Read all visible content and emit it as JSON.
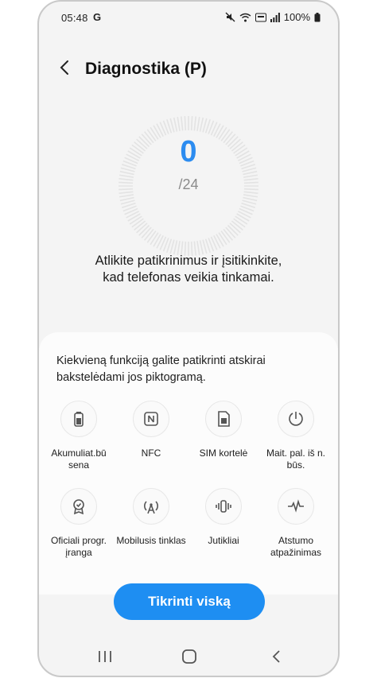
{
  "status_bar": {
    "time": "05:48",
    "google_badge": "G",
    "battery": "100%",
    "icons": [
      "mute-icon",
      "wifi-icon",
      "volte-icon",
      "signal-icon",
      "battery-icon"
    ]
  },
  "header": {
    "title": "Diagnostika (P)",
    "back_icon": "chevron-left-icon"
  },
  "gauge": {
    "value": "0",
    "total": "/24"
  },
  "description": "Atlikite patikrinimus ir įsitikinkite, kad telefonas veikia tinkamai.",
  "card": {
    "text": "Kiekvieną funkciją galite patikrinti atskirai bakstelėdami jos piktogramą.",
    "items": [
      {
        "label": "Akumuliat.bū sena",
        "icon": "battery-icon"
      },
      {
        "label": "NFC",
        "icon": "nfc-icon"
      },
      {
        "label": "SIM kortelė",
        "icon": "sim-card-icon"
      },
      {
        "label": "Mait. pal. iš n. būs.",
        "icon": "power-off-icon"
      },
      {
        "label": "Oficiali progr. įranga",
        "icon": "certificate-icon"
      },
      {
        "label": "Mobilusis tinklas",
        "icon": "antenna-icon"
      },
      {
        "label": "Jutikliai",
        "icon": "vibration-icon"
      },
      {
        "label": "Atstumo atpažinimas",
        "icon": "proximity-wave-icon"
      }
    ]
  },
  "check_all_button": "Tikrinti viską",
  "nav": [
    "recents-icon",
    "home-icon",
    "back-icon"
  ],
  "colors": {
    "accent": "#1e8ef2",
    "background": "#f4f4f4",
    "card": "#fcfcfc"
  }
}
